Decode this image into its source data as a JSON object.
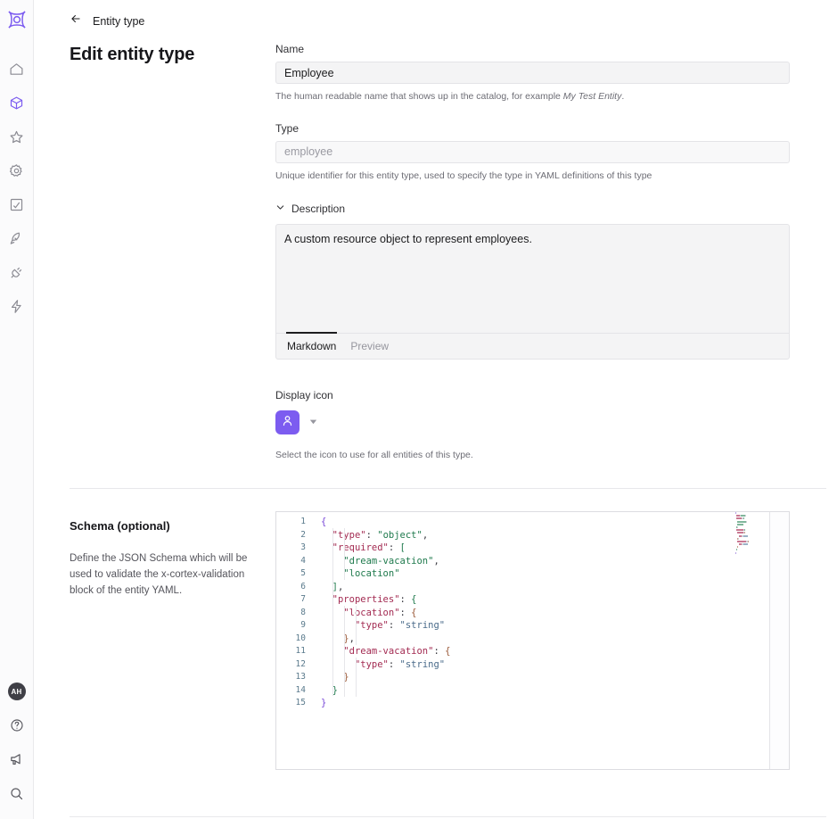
{
  "app": {
    "logo_name": "cortex-logo",
    "accent_color": "#7c5cf0"
  },
  "sidebar": {
    "top_items": [
      {
        "name": "home",
        "icon": "home-icon",
        "active": false
      },
      {
        "name": "catalog",
        "icon": "cube-icon",
        "active": true
      },
      {
        "name": "favorites",
        "icon": "star-icon",
        "active": false
      },
      {
        "name": "settings",
        "icon": "gear-icon",
        "active": false
      },
      {
        "name": "scorecards",
        "icon": "checkbox-square-icon",
        "active": false
      },
      {
        "name": "initiatives",
        "icon": "rocket-icon",
        "active": false
      },
      {
        "name": "integrations",
        "icon": "plug-icon",
        "active": false
      },
      {
        "name": "actions",
        "icon": "lightning-icon",
        "active": false
      }
    ],
    "bottom_items": [
      {
        "name": "user-avatar",
        "icon": "avatar",
        "label": "AH"
      },
      {
        "name": "help",
        "icon": "question-circle-icon",
        "label": ""
      },
      {
        "name": "announcements",
        "icon": "megaphone-icon",
        "label": ""
      },
      {
        "name": "search",
        "icon": "search-icon",
        "label": ""
      }
    ]
  },
  "header": {
    "back_icon": "arrow-left-icon",
    "breadcrumb": "Entity type",
    "title": "Edit entity type"
  },
  "form": {
    "name": {
      "label": "Name",
      "value": "Employee",
      "placeholder": "",
      "help_prefix": "The human readable name that shows up in the catalog, for example ",
      "help_italic": "My Test Entity",
      "help_suffix": "."
    },
    "type": {
      "label": "Type",
      "value": "",
      "placeholder": "employee",
      "help": "Unique identifier for this entity type, used to specify the type in YAML definitions of this type"
    },
    "description": {
      "label": "Description",
      "chevron_icon": "chevron-down-icon",
      "value": "A custom resource object to represent employees.",
      "tabs": [
        {
          "label": "Markdown",
          "active": true
        },
        {
          "label": "Preview",
          "active": false
        }
      ]
    },
    "display_icon": {
      "label": "Display icon",
      "swatch_icon": "person-icon",
      "caret_icon": "caret-down-icon",
      "help": "Select the icon to use for all entities of this type."
    }
  },
  "schema": {
    "title": "Schema (optional)",
    "description": "Define the JSON Schema which will be used to validate the x-cortex-validation block of the entity YAML.",
    "line_numbers": [
      "1",
      "2",
      "3",
      "4",
      "5",
      "6",
      "7",
      "8",
      "9",
      "10",
      "11",
      "12",
      "13",
      "14",
      "15"
    ],
    "code_lines": [
      [
        {
          "t": "{",
          "c": "b1"
        }
      ],
      [
        {
          "t": "  ",
          "c": "p"
        },
        {
          "t": "\"type\"",
          "c": "k"
        },
        {
          "t": ": ",
          "c": "p"
        },
        {
          "t": "\"object\"",
          "c": "s"
        },
        {
          "t": ",",
          "c": "p"
        }
      ],
      [
        {
          "t": "  ",
          "c": "p"
        },
        {
          "t": "\"required\"",
          "c": "k"
        },
        {
          "t": ": ",
          "c": "p"
        },
        {
          "t": "[",
          "c": "b2"
        }
      ],
      [
        {
          "t": "    ",
          "c": "p"
        },
        {
          "t": "\"dream-vacation\"",
          "c": "s"
        },
        {
          "t": ",",
          "c": "p"
        }
      ],
      [
        {
          "t": "    ",
          "c": "p"
        },
        {
          "t": "\"location\"",
          "c": "s"
        }
      ],
      [
        {
          "t": "  ",
          "c": "p"
        },
        {
          "t": "]",
          "c": "b2"
        },
        {
          "t": ",",
          "c": "p"
        }
      ],
      [
        {
          "t": "  ",
          "c": "p"
        },
        {
          "t": "\"properties\"",
          "c": "k"
        },
        {
          "t": ": ",
          "c": "p"
        },
        {
          "t": "{",
          "c": "b2"
        }
      ],
      [
        {
          "t": "    ",
          "c": "p"
        },
        {
          "t": "\"location\"",
          "c": "k"
        },
        {
          "t": ": ",
          "c": "p"
        },
        {
          "t": "{",
          "c": "b3"
        }
      ],
      [
        {
          "t": "      ",
          "c": "p"
        },
        {
          "t": "\"type\"",
          "c": "k"
        },
        {
          "t": ": ",
          "c": "p"
        },
        {
          "t": "\"string\"",
          "c": "sb"
        }
      ],
      [
        {
          "t": "    ",
          "c": "p"
        },
        {
          "t": "}",
          "c": "b3"
        },
        {
          "t": ",",
          "c": "p"
        }
      ],
      [
        {
          "t": "    ",
          "c": "p"
        },
        {
          "t": "\"dream-vacation\"",
          "c": "k"
        },
        {
          "t": ": ",
          "c": "p"
        },
        {
          "t": "{",
          "c": "b3"
        }
      ],
      [
        {
          "t": "      ",
          "c": "p"
        },
        {
          "t": "\"type\"",
          "c": "k"
        },
        {
          "t": ": ",
          "c": "p"
        },
        {
          "t": "\"string\"",
          "c": "sb"
        }
      ],
      [
        {
          "t": "    ",
          "c": "p"
        },
        {
          "t": "}",
          "c": "b3"
        }
      ],
      [
        {
          "t": "  ",
          "c": "p"
        },
        {
          "t": "}",
          "c": "b2"
        }
      ],
      [
        {
          "t": "}",
          "c": "b1"
        }
      ]
    ]
  }
}
